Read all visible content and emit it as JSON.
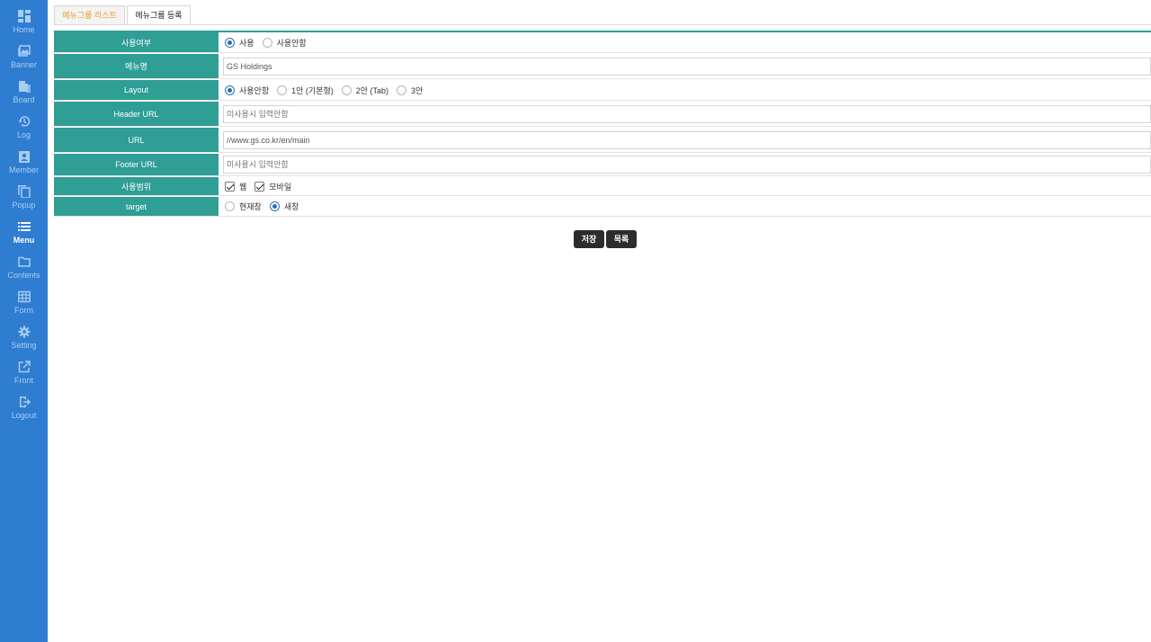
{
  "sidebar": {
    "items": [
      {
        "label": "Home",
        "icon": "dashboard-icon"
      },
      {
        "label": "Banner",
        "icon": "image-icon"
      },
      {
        "label": "Board",
        "icon": "board-icon"
      },
      {
        "label": "Log",
        "icon": "history-icon"
      },
      {
        "label": "Member",
        "icon": "member-icon"
      },
      {
        "label": "Popup",
        "icon": "popup-icon"
      },
      {
        "label": "Menu",
        "icon": "list-icon",
        "active": true
      },
      {
        "label": "Contents",
        "icon": "folder-icon"
      },
      {
        "label": "Form",
        "icon": "table-icon"
      },
      {
        "label": "Setting",
        "icon": "gear-icon"
      },
      {
        "label": "Front",
        "icon": "external-link-icon"
      },
      {
        "label": "Logout",
        "icon": "logout-icon"
      }
    ]
  },
  "tabs": {
    "list": "메뉴그룹 리스트",
    "register": "메뉴그룹 등록"
  },
  "form": {
    "use": {
      "label": "사용여부",
      "options": [
        "사용",
        "사용안함"
      ],
      "selected": "사용"
    },
    "menu_name": {
      "label": "메뉴명",
      "value": "GS Holdings"
    },
    "layout": {
      "label": "Layout",
      "options": [
        "사용안함",
        "1안 (기본형)",
        "2안 (Tab)",
        "3안"
      ],
      "selected": "사용안함"
    },
    "header_url": {
      "label": "Header URL",
      "placeholder": "미사용시 입력안함"
    },
    "url": {
      "label": "URL",
      "value": "//www.gs.co.kr/en/main"
    },
    "footer_url": {
      "label": "Footer URL",
      "placeholder": "미사용시 입력안함"
    },
    "scope": {
      "label": "사용범위",
      "options": [
        "웹",
        "모바일"
      ],
      "checked": [
        "웹",
        "모바일"
      ]
    },
    "target": {
      "label": "target",
      "options": [
        "현재창",
        "새창"
      ],
      "selected": "새창"
    }
  },
  "buttons": {
    "save": "저장",
    "list": "목록"
  },
  "colors": {
    "sidebar": "#2f7dd1",
    "header_cell": "#2f9e95",
    "tab_active_text": "#ef9a31",
    "button": "#2c2c2c"
  }
}
